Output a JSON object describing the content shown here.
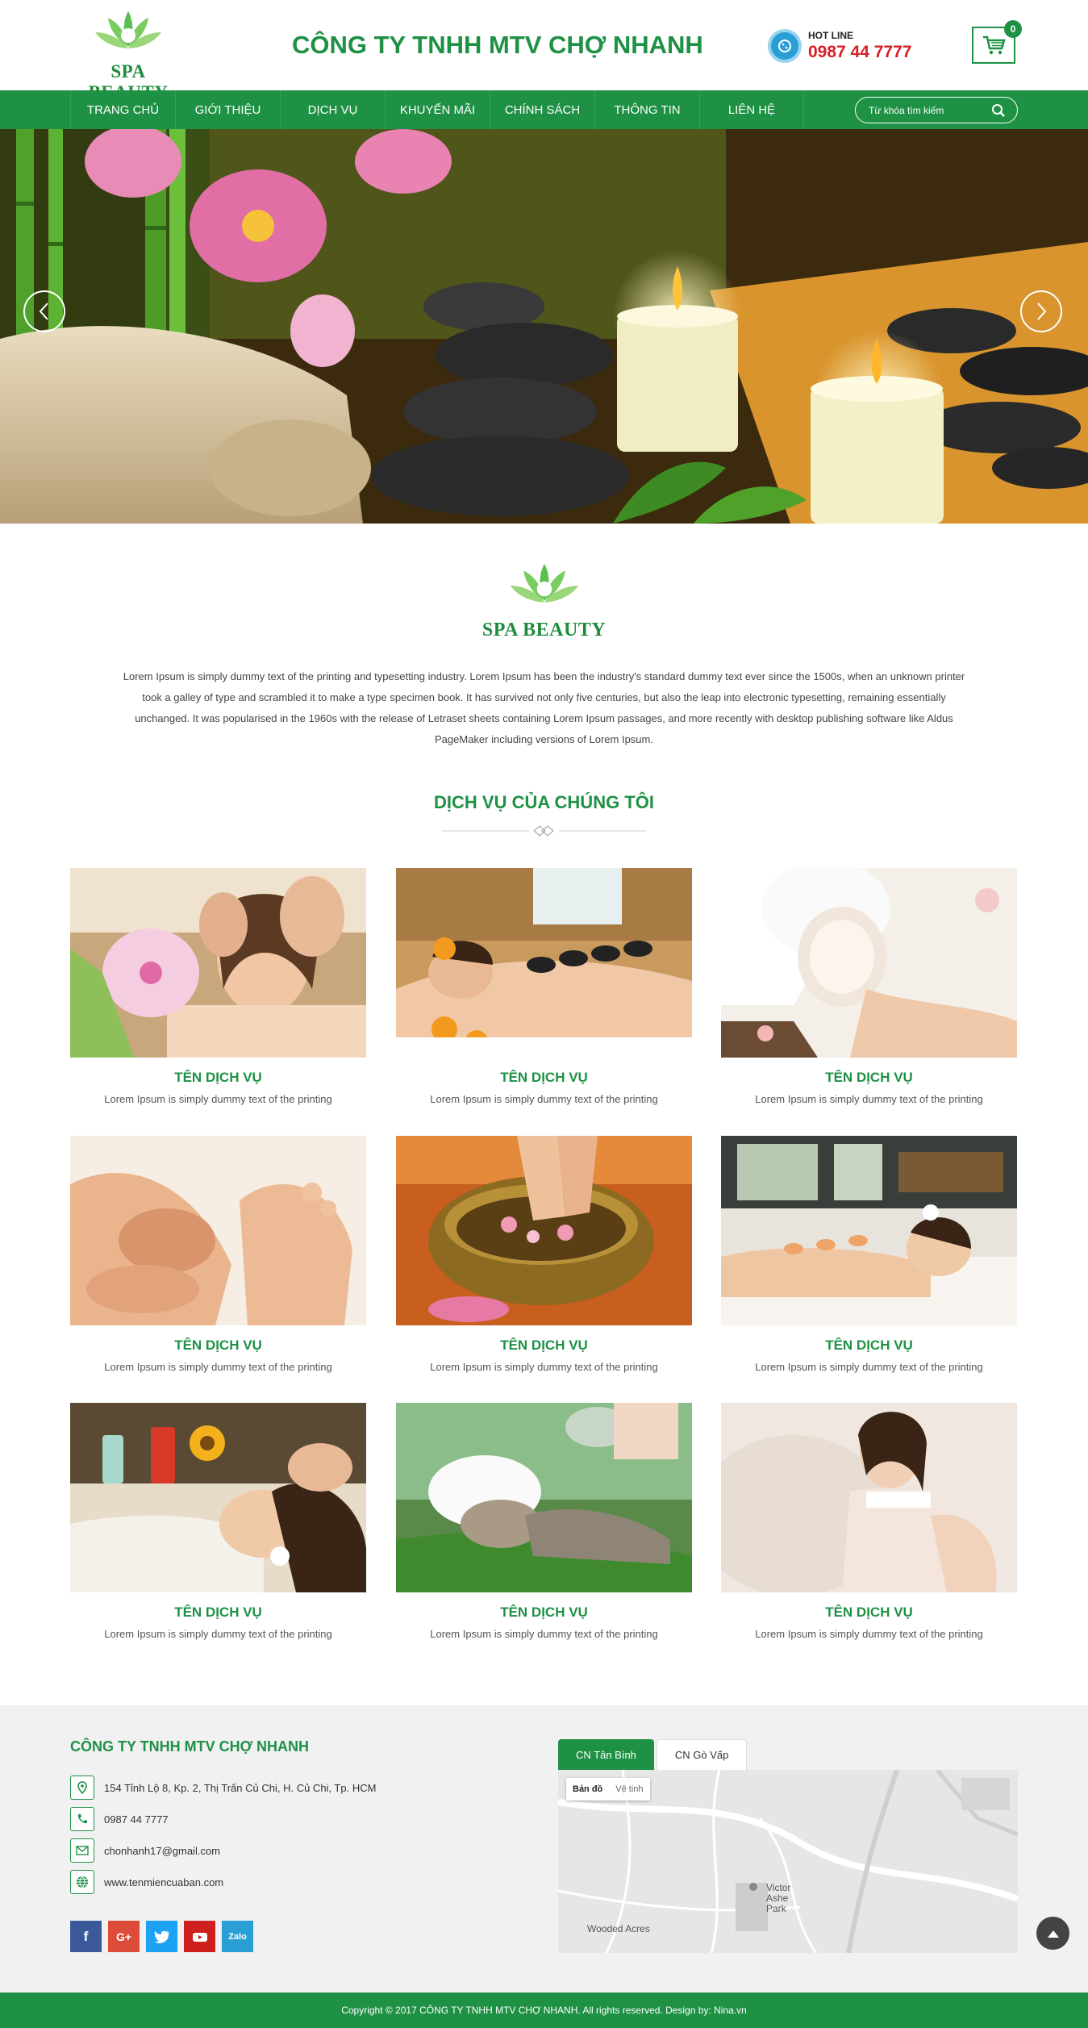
{
  "header": {
    "logo_text": "SPA BEAUTY",
    "company_name": "CÔNG TY TNHH MTV CHỢ NHANH",
    "hotline_label": "HOT LINE",
    "hotline_number": "0987 44 7777",
    "cart_count": "0"
  },
  "nav": {
    "items": [
      {
        "label": "TRANG CHỦ"
      },
      {
        "label": "GIỚI THIỆU"
      },
      {
        "label": "DỊCH VỤ"
      },
      {
        "label": "KHUYẾN MÃI"
      },
      {
        "label": "CHÍNH SÁCH"
      },
      {
        "label": "THÔNG TIN"
      },
      {
        "label": "LIÊN HỆ"
      }
    ],
    "search_placeholder": "Từ khóa tìm kiếm"
  },
  "intro": {
    "logo_text": "SPA BEAUTY",
    "text": "Lorem Ipsum is simply dummy text of the printing and typesetting industry. Lorem Ipsum has been the industry's standard dummy text ever since the 1500s, when an unknown printer took a galley of type and scrambled it to make a type specimen book. It has survived not only five centuries, but also the leap into electronic typesetting, remaining essentially unchanged. It was popularised in the 1960s with the release of Letraset sheets containing Lorem Ipsum passages, and more recently with desktop publishing software like Aldus PageMaker including versions of Lorem Ipsum."
  },
  "services": {
    "title": "DỊCH VỤ CỦA CHÚNG TÔI",
    "items": [
      {
        "name": "TÊN DỊCH VỤ",
        "desc": "Lorem Ipsum is simply dummy text of the printing"
      },
      {
        "name": "TÊN DỊCH VỤ",
        "desc": "Lorem Ipsum is simply dummy text of the printing"
      },
      {
        "name": "TÊN DỊCH VỤ",
        "desc": "Lorem Ipsum is simply dummy text of the printing"
      },
      {
        "name": "TÊN DỊCH VỤ",
        "desc": "Lorem Ipsum is simply dummy text of the printing"
      },
      {
        "name": "TÊN DỊCH VỤ",
        "desc": "Lorem Ipsum is simply dummy text of the printing"
      },
      {
        "name": "TÊN DỊCH VỤ",
        "desc": "Lorem Ipsum is simply dummy text of the printing"
      },
      {
        "name": "TÊN DỊCH VỤ",
        "desc": "Lorem Ipsum is simply dummy text of the printing"
      },
      {
        "name": "TÊN DỊCH VỤ",
        "desc": "Lorem Ipsum is simply dummy text of the printing"
      },
      {
        "name": "TÊN DỊCH VỤ",
        "desc": "Lorem Ipsum is simply dummy text of the printing"
      }
    ]
  },
  "footer": {
    "company": "CÔNG TY TNHH MTV CHỢ NHANH",
    "address": "154 Tỉnh Lộ 8, Kp. 2, Thị Trấn Củ Chi, H. Củ Chi, Tp. HCM",
    "phone": "0987 44 7777",
    "email": "chonhanh17@gmail.com",
    "website": "www.tenmiencuaban.com",
    "socials": [
      "facebook-icon",
      "google-plus-icon",
      "twitter-icon",
      "youtube-icon",
      "zalo-icon"
    ],
    "zalo_label": "Zalo",
    "tabs": [
      {
        "label": "CN Tân Bình"
      },
      {
        "label": "CN Gò Vấp"
      }
    ],
    "map_controls": {
      "map": "Bản đồ",
      "satellite": "Vệ tinh"
    },
    "map_labels": {
      "park": "Victor Ashe Park",
      "area": "Wooded Acres"
    },
    "copyright": "Copyright © 2017 CÔNG TY TNHH MTV CHỢ NHANH.  All rights reserved. Design by: Nina.vn"
  },
  "colors": {
    "primary": "#1e9145",
    "hotline": "#d81f26",
    "footer_bg": "#f1f1f1"
  }
}
